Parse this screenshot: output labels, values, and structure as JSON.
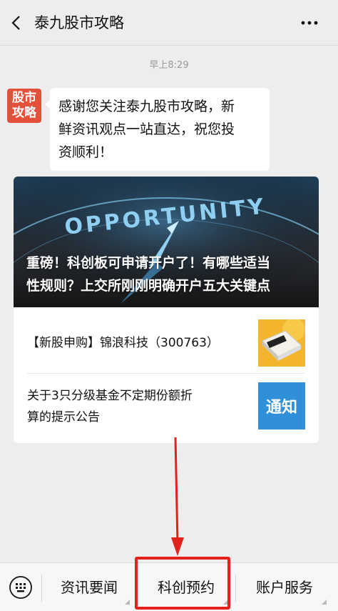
{
  "header": {
    "title": "泰九股市攻略"
  },
  "chat": {
    "timestamp": "早上8:29",
    "avatar_text_line1": "股市",
    "avatar_text_line2": "攻略",
    "welcome_line1": "感谢您关注泰九股市攻略，新",
    "welcome_line2": "鲜资讯观点一站直达，祝您投",
    "welcome_line3": "资顺利！"
  },
  "news_card": {
    "cover_title_line1": "重磅！科创板可申请开户了！有哪些适当",
    "cover_title_line2": "性规则？上交所刚刚明确开户五大关键点",
    "cover_image_word": "OPPORTUNITY",
    "articles": [
      {
        "title": "【新股申购】锦浪科技（300763）",
        "thumb": "newspaper-thumbnail"
      },
      {
        "title_line1": "关于3只分级基金不定期份额折",
        "title_line2": "算的提示公告",
        "thumb_text": "通知"
      }
    ]
  },
  "bottom_menu": {
    "items": [
      "资讯要闻",
      "科创预约",
      "账户服务"
    ]
  },
  "colors": {
    "annotation_red": "#e3221b",
    "avatar_bg": "#e4513a",
    "notice_blue": "#2f8fd8"
  }
}
